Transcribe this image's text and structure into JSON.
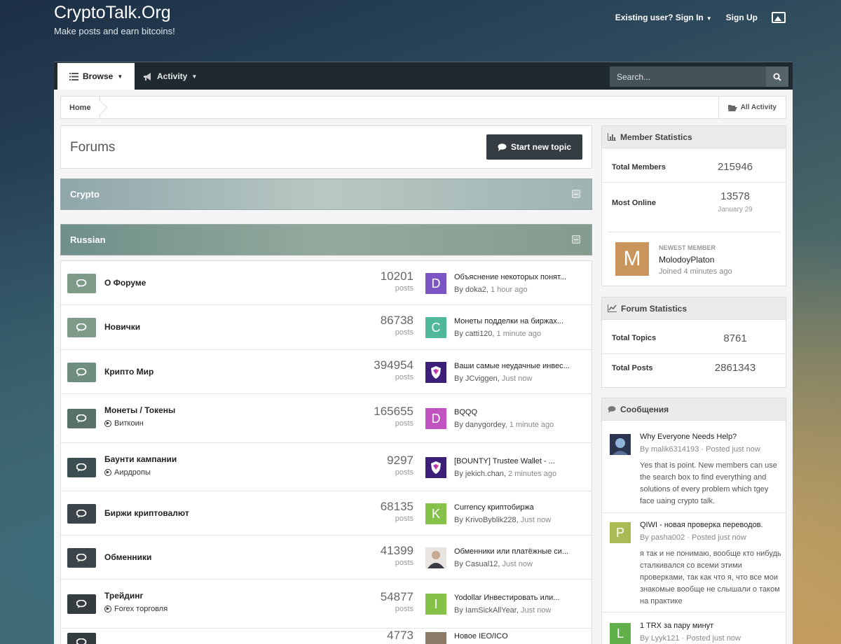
{
  "header": {
    "site_title": "CryptoTalk.Org",
    "tagline": "Make posts and earn bitcoins!",
    "sign_in": "Existing user? Sign In",
    "sign_up": "Sign Up"
  },
  "nav": {
    "browse": "Browse",
    "activity": "Activity",
    "search_placeholder": "Search..."
  },
  "breadcrumb": {
    "home": "Home",
    "all_activity": "All Activity"
  },
  "forums": {
    "title": "Forums",
    "start_topic": "Start new topic",
    "categories": [
      {
        "name": "Crypto"
      },
      {
        "name": "Russian"
      }
    ],
    "rows": [
      {
        "name": "О Форуме",
        "sub": "",
        "count": "10201",
        "count_label": "posts",
        "last_title": "Объяснение некоторых понят...",
        "last_by": "By doka2,",
        "last_time": "1 hour ago",
        "avatar": "D",
        "avatar_color": "#7b55c4",
        "icon_color": "#7e9a88"
      },
      {
        "name": "Новички",
        "sub": "",
        "count": "86738",
        "count_label": "posts",
        "last_title": "Монеты подделки на биржах...",
        "last_by": "By catti120,",
        "last_time": "1 minute ago",
        "avatar": "C",
        "avatar_color": "#4fb89a",
        "icon_color": "#7e9a88"
      },
      {
        "name": "Крипто Мир",
        "sub": "",
        "count": "394954",
        "count_label": "posts",
        "last_title": "Ваши самые неудачные инвес...",
        "last_by": "By JCviggen,",
        "last_time": "Just now",
        "avatar": "shield",
        "avatar_color": "#3d1f7a",
        "icon_color": "#6f8e7e"
      },
      {
        "name": "Монеты / Токены",
        "sub": "Виткоин",
        "count": "165655",
        "count_label": "posts",
        "last_title": "BQQQ",
        "last_by": "By danygordey,",
        "last_time": "1 minute ago",
        "avatar": "D",
        "avatar_color": "#c254c2",
        "icon_color": "#57706a"
      },
      {
        "name": "Баунти кампании",
        "sub": "Аирдропы",
        "count": "9297",
        "count_label": "posts",
        "last_title": "[BOUNTY] Trustee Wallet - ...",
        "last_by": "By jekich.chan,",
        "last_time": "2 minutes ago",
        "avatar": "shield",
        "avatar_color": "#3d1f7a",
        "icon_color": "#3d4e52"
      },
      {
        "name": "Биржи криптовалют",
        "sub": "",
        "count": "68135",
        "count_label": "posts",
        "last_title": "Currency криптобиржа",
        "last_by": "By KrivoByblik228,",
        "last_time": "Just now",
        "avatar": "K",
        "avatar_color": "#86c24a",
        "icon_color": "#3b4448"
      },
      {
        "name": "Обменники",
        "sub": "",
        "count": "41399",
        "count_label": "posts",
        "last_title": "Обменники или платёжные си...",
        "last_by": "By Casual12,",
        "last_time": "Just now",
        "avatar": "photo",
        "avatar_color": "#9a8c84",
        "icon_color": "#3b4448"
      },
      {
        "name": "Трейдинг",
        "sub": "Forex торговля",
        "count": "54877",
        "count_label": "posts",
        "last_title": "Yodollar Инвестировать или...",
        "last_by": "By IamSickAllYear,",
        "last_time": "Just now",
        "avatar": "I",
        "avatar_color": "#86c24a",
        "icon_color": "#353c3f"
      },
      {
        "name": "",
        "sub": "",
        "count": "4773",
        "count_label": "",
        "last_title": "Новое IEO/ICO",
        "last_by": "",
        "last_time": "",
        "avatar": "",
        "avatar_color": "#8a7a66",
        "icon_color": "#353c3f"
      }
    ]
  },
  "member_stats": {
    "title": "Member Statistics",
    "total_members_label": "Total Members",
    "total_members": "215946",
    "most_online_label": "Most Online",
    "most_online": "13578",
    "most_online_date": "January 29",
    "newest_label": "NEWEST MEMBER",
    "newest_name": "MolodoyPlaton",
    "newest_joined": "Joined 4 minutes ago",
    "newest_avatar": "M",
    "newest_avatar_color": "#c9955a"
  },
  "forum_stats": {
    "title": "Forum Statistics",
    "total_topics_label": "Total Topics",
    "total_topics": "8761",
    "total_posts_label": "Total Posts",
    "total_posts": "2861343"
  },
  "messages": {
    "title": "Сообщения",
    "items": [
      {
        "title": "Why Everyone Needs Help?",
        "meta": "By malik6314193 · Posted just now",
        "body": "Yes that is point. New members can use the search box to find everything and solutions of every problem which tgey face uaing crypto talk.",
        "avatar": "photo",
        "avatar_color": "#3a4a6a"
      },
      {
        "title": "QIWI - новая проверка переводов.",
        "meta": "By pasha002 · Posted just now",
        "body": "я так и не понимаю, вообще кто нибудь сталкивался со всеми этими проверками, так как что я, что все мои знакомые вообще не слышали о таком на практике",
        "avatar": "P",
        "avatar_color": "#aabb55"
      },
      {
        "title": "1 TRX за пару минут",
        "meta": "By Lyyk121 · Posted just now",
        "body": "",
        "avatar": "L",
        "avatar_color": "#62b04a"
      }
    ]
  },
  "colors": {
    "nav_bg": "#1f2a30",
    "button_dark": "#353c42"
  }
}
